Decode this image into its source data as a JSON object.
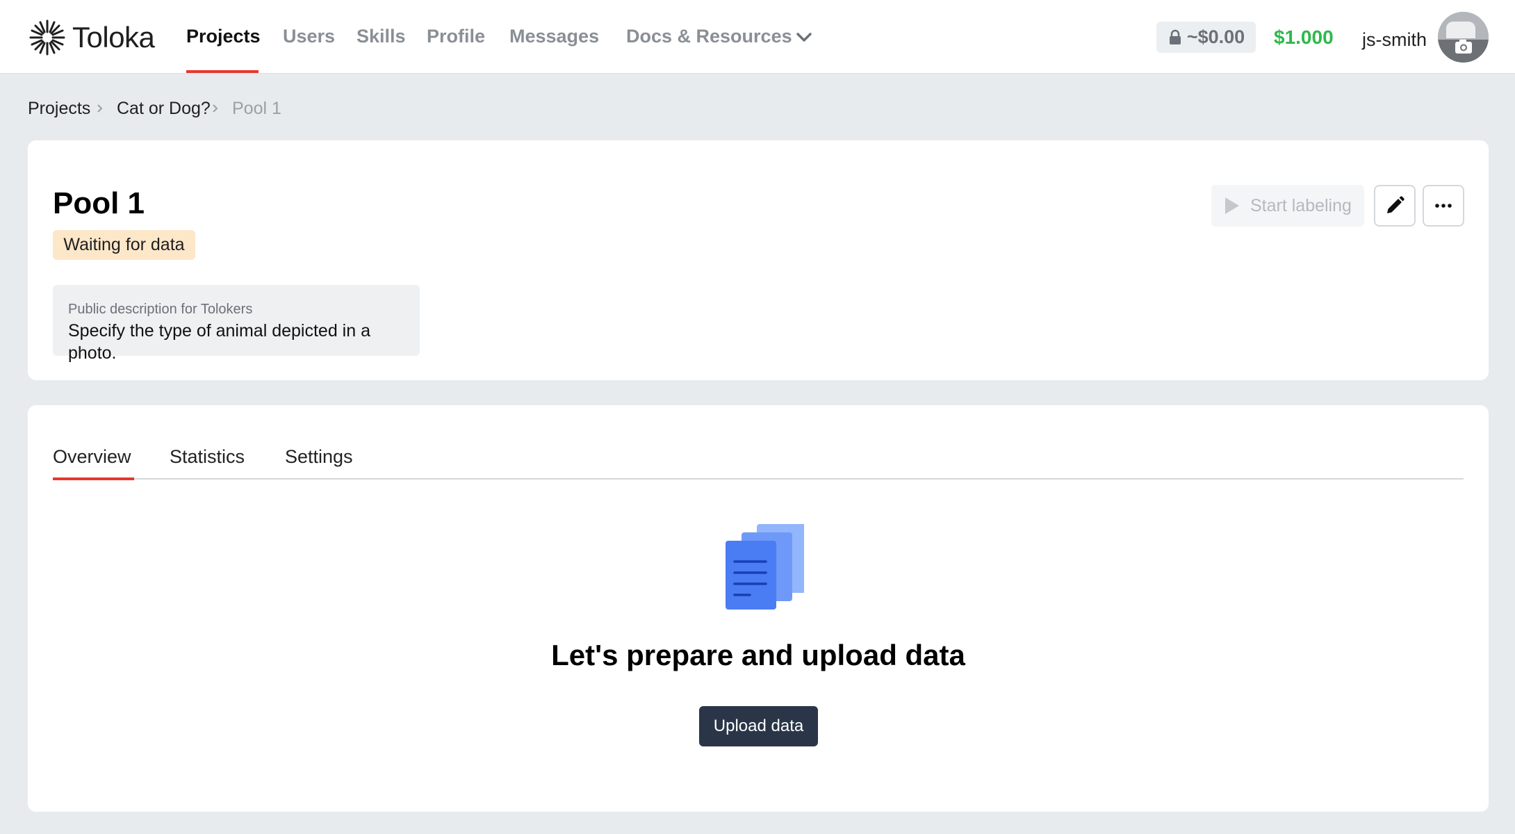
{
  "header": {
    "logo_text": "Toloka",
    "nav": [
      {
        "label": "Projects",
        "active": true
      },
      {
        "label": "Users"
      },
      {
        "label": "Skills"
      },
      {
        "label": "Profile"
      },
      {
        "label": "Messages"
      },
      {
        "label": "Docs & Resources"
      }
    ],
    "locked_balance": "~$0.00",
    "balance": "$1.000",
    "username": "js-smith"
  },
  "breadcrumb": [
    "Projects",
    "Cat or Dog?",
    "Pool 1"
  ],
  "pool": {
    "title": "Pool 1",
    "status": "Waiting for data",
    "description_label": "Public description for Tolokers",
    "description": "Specify the type of animal depicted in a photo.",
    "start_label": "Start labeling"
  },
  "tabs": [
    {
      "label": "Overview",
      "active": true
    },
    {
      "label": "Statistics"
    },
    {
      "label": "Settings"
    }
  ],
  "empty_state": {
    "title": "Let's prepare and upload data",
    "button": "Upload data"
  },
  "colors": {
    "accent_red": "#e8372e",
    "balance_green": "#2fb84a",
    "status_bg": "#fde7c9",
    "primary_button": "#2a3648"
  }
}
